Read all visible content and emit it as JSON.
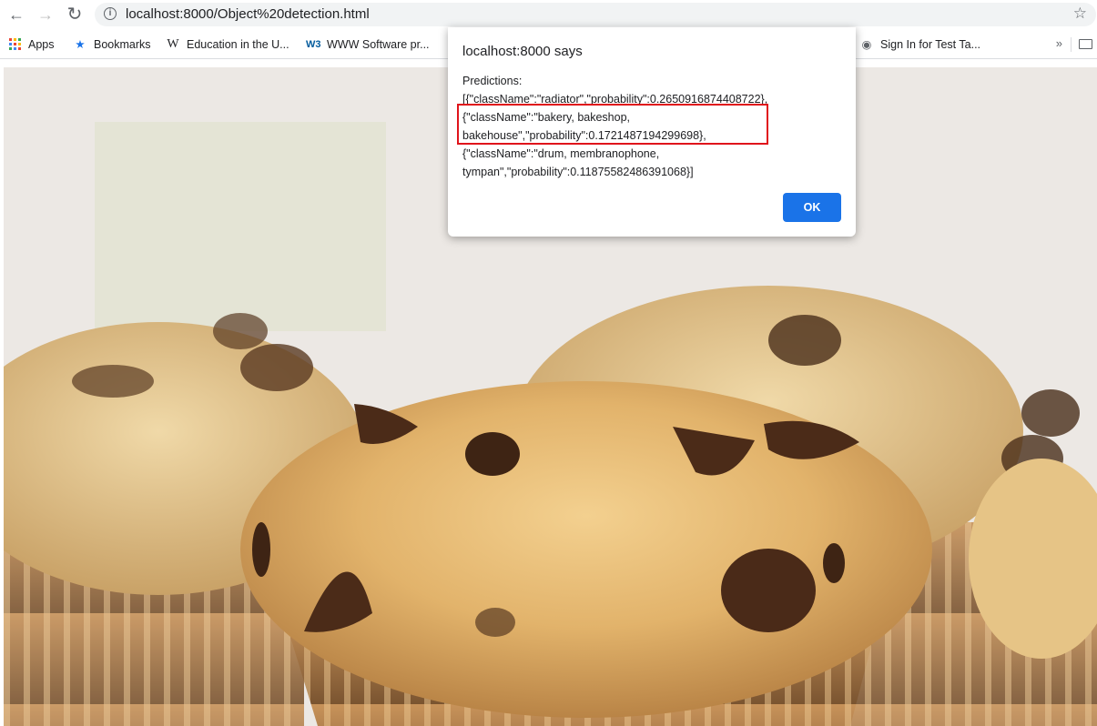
{
  "browser": {
    "url": "localhost:8000/Object%20detection.html",
    "nav": {
      "back": "←",
      "forward": "→",
      "reload": "↻"
    },
    "star_icon": "☆"
  },
  "bookmarks": [
    {
      "label": "Apps",
      "icon": "apps-grid-icon"
    },
    {
      "label": "Bookmarks",
      "icon": "star-icon"
    },
    {
      "label": "Education in the U...",
      "icon": "wikipedia-icon"
    },
    {
      "label": "WWW Software pr...",
      "icon": "w3c-icon"
    },
    {
      "label": "Sign In for Test Ta...",
      "icon": "globe-icon"
    }
  ],
  "bookmarks_overflow": "»",
  "dialog": {
    "title": "localhost:8000 says",
    "message_lines": [
      "Predictions:",
      "[{\"className\":\"radiator\",\"probability\":0.2650916874408722},",
      "{\"className\":\"bakery, bakeshop,",
      "bakehouse\",\"probability\":0.1721487194299698},",
      "{\"className\":\"drum, membranophone,",
      "tympan\",\"probability\":0.11875582486391068}]"
    ],
    "ok_label": "OK"
  },
  "colors": {
    "accent": "#1a73e8",
    "highlight": "#e0141b",
    "omnibox_bg": "#f1f3f4"
  }
}
